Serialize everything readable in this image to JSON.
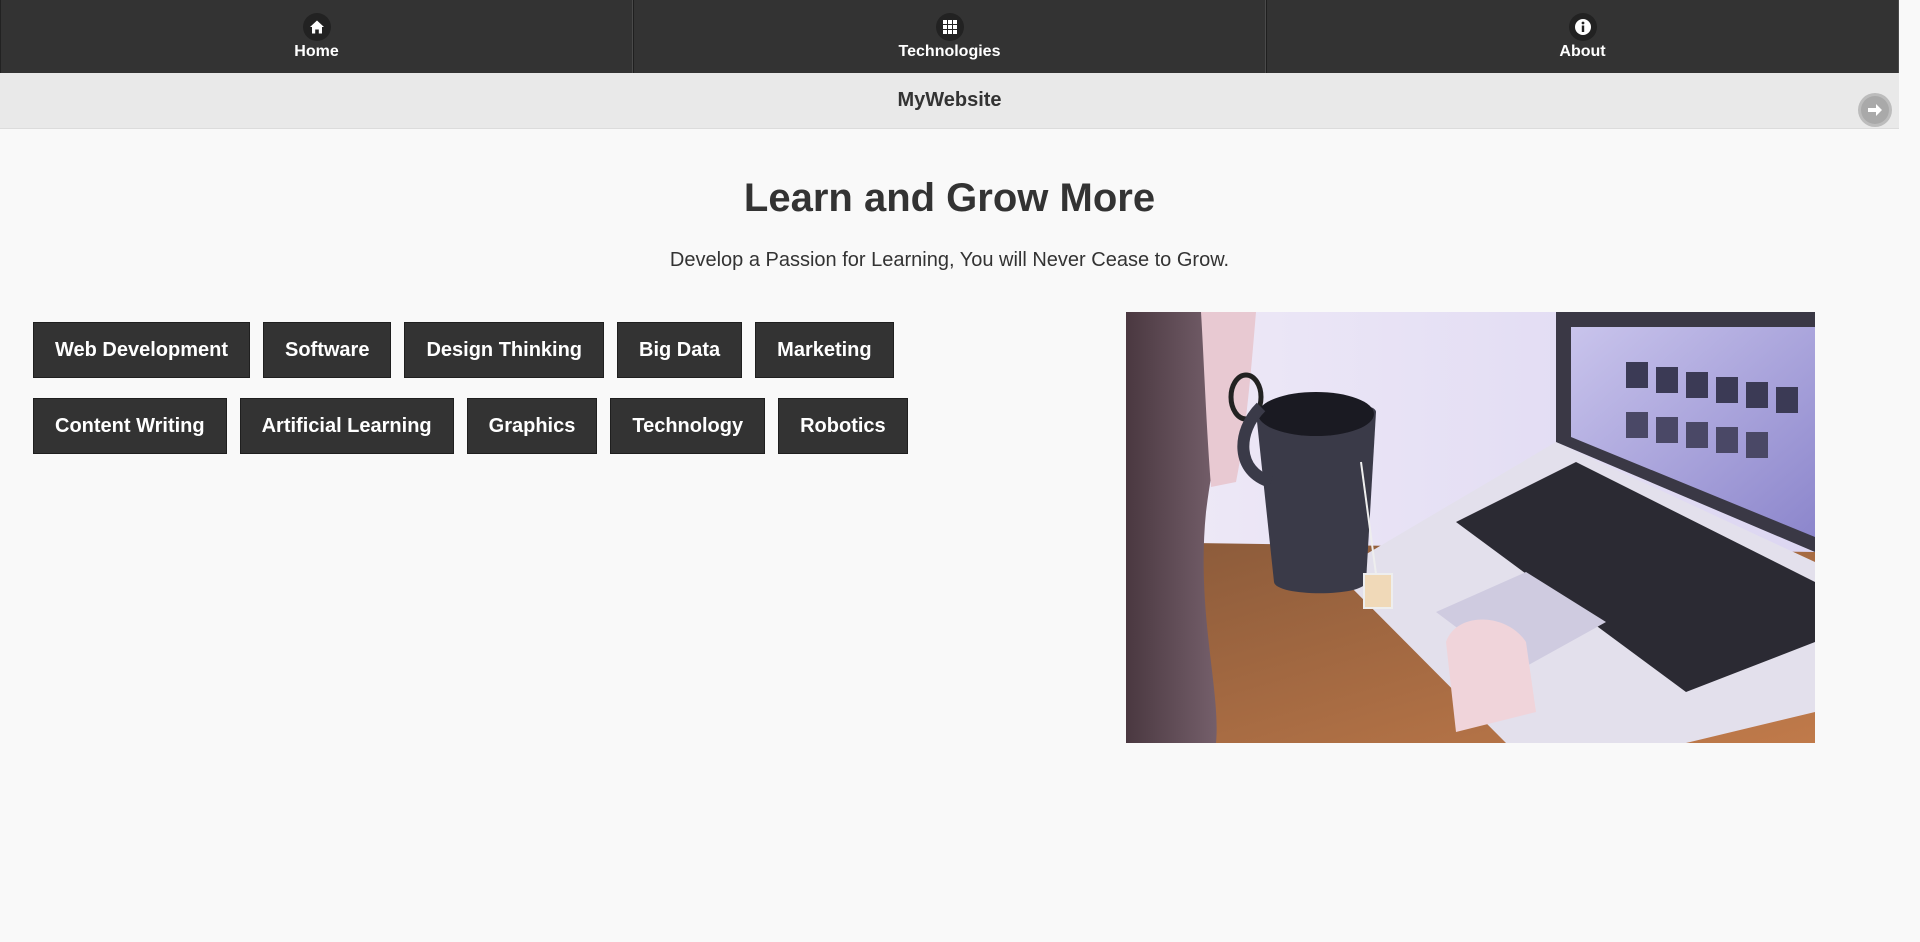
{
  "navbar": {
    "items": [
      {
        "label": "Home",
        "icon": "home-icon"
      },
      {
        "label": "Technologies",
        "icon": "grid-icon"
      },
      {
        "label": "About",
        "icon": "info-icon"
      }
    ]
  },
  "header": {
    "title": "MyWebsite",
    "next_icon": "arrow-right-icon"
  },
  "hero": {
    "title": "Learn and Grow More",
    "subtitle": "Develop a Passion for Learning, You will Never Cease to Grow."
  },
  "topics": [
    "Web Development",
    "Software",
    "Design Thinking",
    "Big Data",
    "Marketing",
    "Content Writing",
    "Artificial Learning",
    "Graphics",
    "Technology",
    "Robotics"
  ],
  "colors": {
    "nav_background": "#333333",
    "header_background": "#e9e9e9",
    "page_background": "#f9f9f9",
    "button_background": "#333333"
  }
}
